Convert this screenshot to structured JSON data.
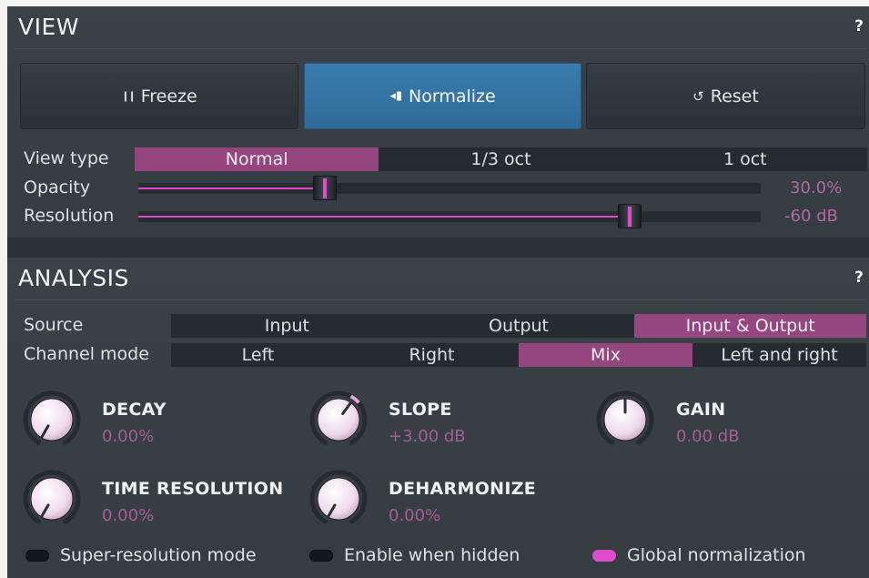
{
  "view": {
    "title": "VIEW",
    "help": "?",
    "buttons": [
      {
        "label": "Freeze",
        "icon": "pause-icon",
        "glyph": "❙❙",
        "active": false
      },
      {
        "label": "Normalize",
        "icon": "normalize-icon",
        "glyph": "◂▮",
        "active": true
      },
      {
        "label": "Reset",
        "icon": "reset-icon",
        "glyph": "↺",
        "active": false
      }
    ],
    "view_type": {
      "label": "View type",
      "options": [
        "Normal",
        "1/3 oct",
        "1 oct"
      ],
      "selected": "Normal"
    },
    "opacity": {
      "label": "Opacity",
      "value": "30.0%",
      "fraction": 0.3
    },
    "resolution": {
      "label": "Resolution",
      "value": "-60 dB",
      "fraction": 0.79
    }
  },
  "analysis": {
    "title": "ANALYSIS",
    "help": "?",
    "source": {
      "label": "Source",
      "options": [
        "Input",
        "Output",
        "Input & Output"
      ],
      "selected": "Input & Output"
    },
    "channel_mode": {
      "label": "Channel mode",
      "options": [
        "Left",
        "Right",
        "Mix",
        "Left and right"
      ],
      "selected": "Mix"
    },
    "knobs": {
      "decay": {
        "name": "DECAY",
        "value": "0.00%",
        "level": 0.0
      },
      "slope": {
        "name": "SLOPE",
        "value": "+3.00 dB",
        "level": 0.62
      },
      "gain": {
        "name": "GAIN",
        "value": "0.00 dB",
        "level": 0.5
      },
      "time_resolution": {
        "name": "TIME RESOLUTION",
        "value": "0.00%",
        "level": 0.0
      },
      "deharmonize": {
        "name": "DEHARMONIZE",
        "value": "0.00%",
        "level": 0.0
      }
    },
    "toggles": {
      "super_resolution": {
        "label": "Super-resolution mode",
        "on": false
      },
      "enable_hidden": {
        "label": "Enable when hidden",
        "on": false
      },
      "global_norm": {
        "label": "Global normalization",
        "on": true
      }
    }
  },
  "colors": {
    "panel": "#383f45",
    "accent_blue": "#3274a5",
    "accent_magenta": "#95467f",
    "indicator_pink": "#e048c8"
  }
}
